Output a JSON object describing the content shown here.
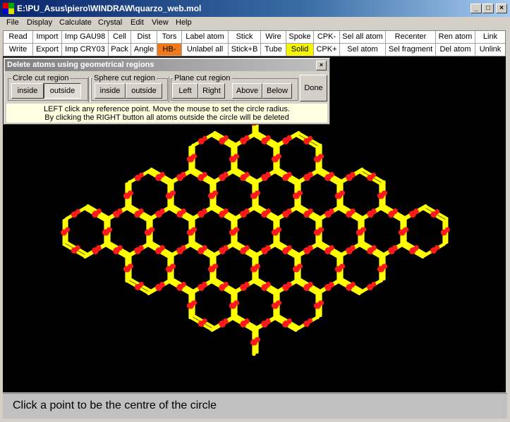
{
  "window": {
    "title": "E:\\PU_Asus\\piero\\WINDRAW\\quarzo_web.mol",
    "minimize": "_",
    "maximize": "□",
    "close": "×"
  },
  "menu": [
    "File",
    "Display",
    "Calculate",
    "Crystal",
    "Edit",
    "View",
    "Help"
  ],
  "toolbar": {
    "row1": [
      "Read",
      "Import",
      "Imp GAU98",
      "Cell",
      "Dist",
      "Tors",
      "Label atom",
      "Stick",
      "Wire",
      "Spoke",
      "CPK-",
      "Sel all atom",
      "Recenter",
      "Ren atom",
      "Link"
    ],
    "row2": [
      "Write",
      "Export",
      "Imp CRY03",
      "Pack",
      "Angle",
      "HB-",
      "Unlabel all",
      "Stick+B",
      "Tube",
      "Solid",
      "CPK+",
      "Sel atom",
      "Sel fragment",
      "Del atom",
      "Unlink"
    ],
    "highlight_hb": "#f07a1a",
    "highlight_solid": "#f5f500"
  },
  "dialog": {
    "title": "Delete atoms using geometrical regions",
    "close": "×",
    "circle_label": "Circle  cut  region",
    "sphere_label": "Sphere  cut  region",
    "plane_label": "Plane cut region",
    "inside": "inside",
    "outside": "outside",
    "left": "Left",
    "right": "Right",
    "above": "Above",
    "below": "Below",
    "done": "Done",
    "msg_line1": "LEFT click any reference point. Move the mouse to set the circle radius.",
    "msg_line2": "By clicking the RIGHT button all atoms outside the circle will be deleted"
  },
  "molecule": {
    "atom_color": "#ff1a1a",
    "bond_color": "#ffff00",
    "background": "#000000"
  },
  "status": "Click a point to be the centre of the circle"
}
